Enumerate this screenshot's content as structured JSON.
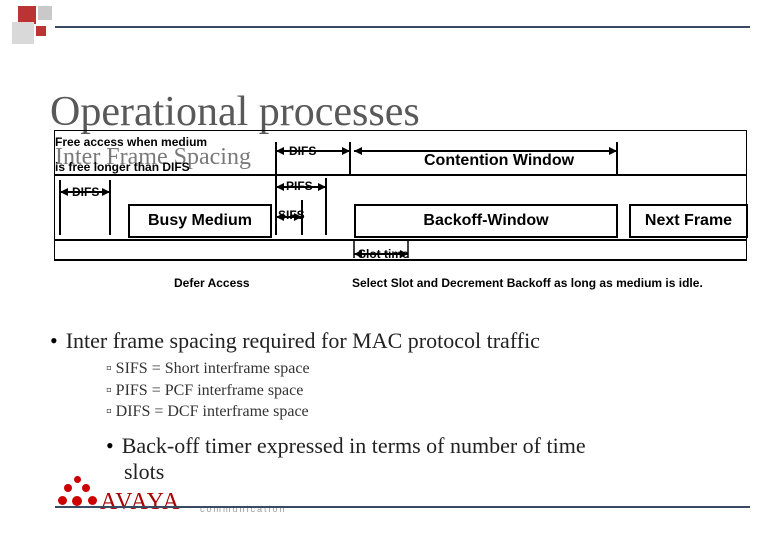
{
  "title": "Operational processes",
  "subtitle": "Inter Frame Spacing",
  "note_line1": "Free access when medium",
  "note_line2": "is free longer than DIFS",
  "diagram": {
    "difs_label_top": "DIFS",
    "difs_label_left": "DIFS",
    "pifs_label": "PIFS",
    "sifs_label": "SIFS",
    "contention_window": "Contention Window",
    "busy_box": "Busy Medium",
    "backoff_box": "Backoff-Window",
    "next_frame_box": "Next Frame",
    "slot_time": "Slot time",
    "defer_access": "Defer Access",
    "select_slot": "Select Slot and Decrement Backoff as long as medium is idle."
  },
  "body": {
    "bullet1": "Inter frame spacing required for MAC protocol traffic",
    "sub1": "SIFS = Short interframe space",
    "sub2": "PIFS = PCF interframe space",
    "sub3": "DIFS = DCF interframe space",
    "bullet2_part1": "Back-off timer expressed in terms of number of time",
    "bullet2_part2": "slots"
  },
  "logo": {
    "brand": "AVAYA",
    "tag": "communication"
  }
}
